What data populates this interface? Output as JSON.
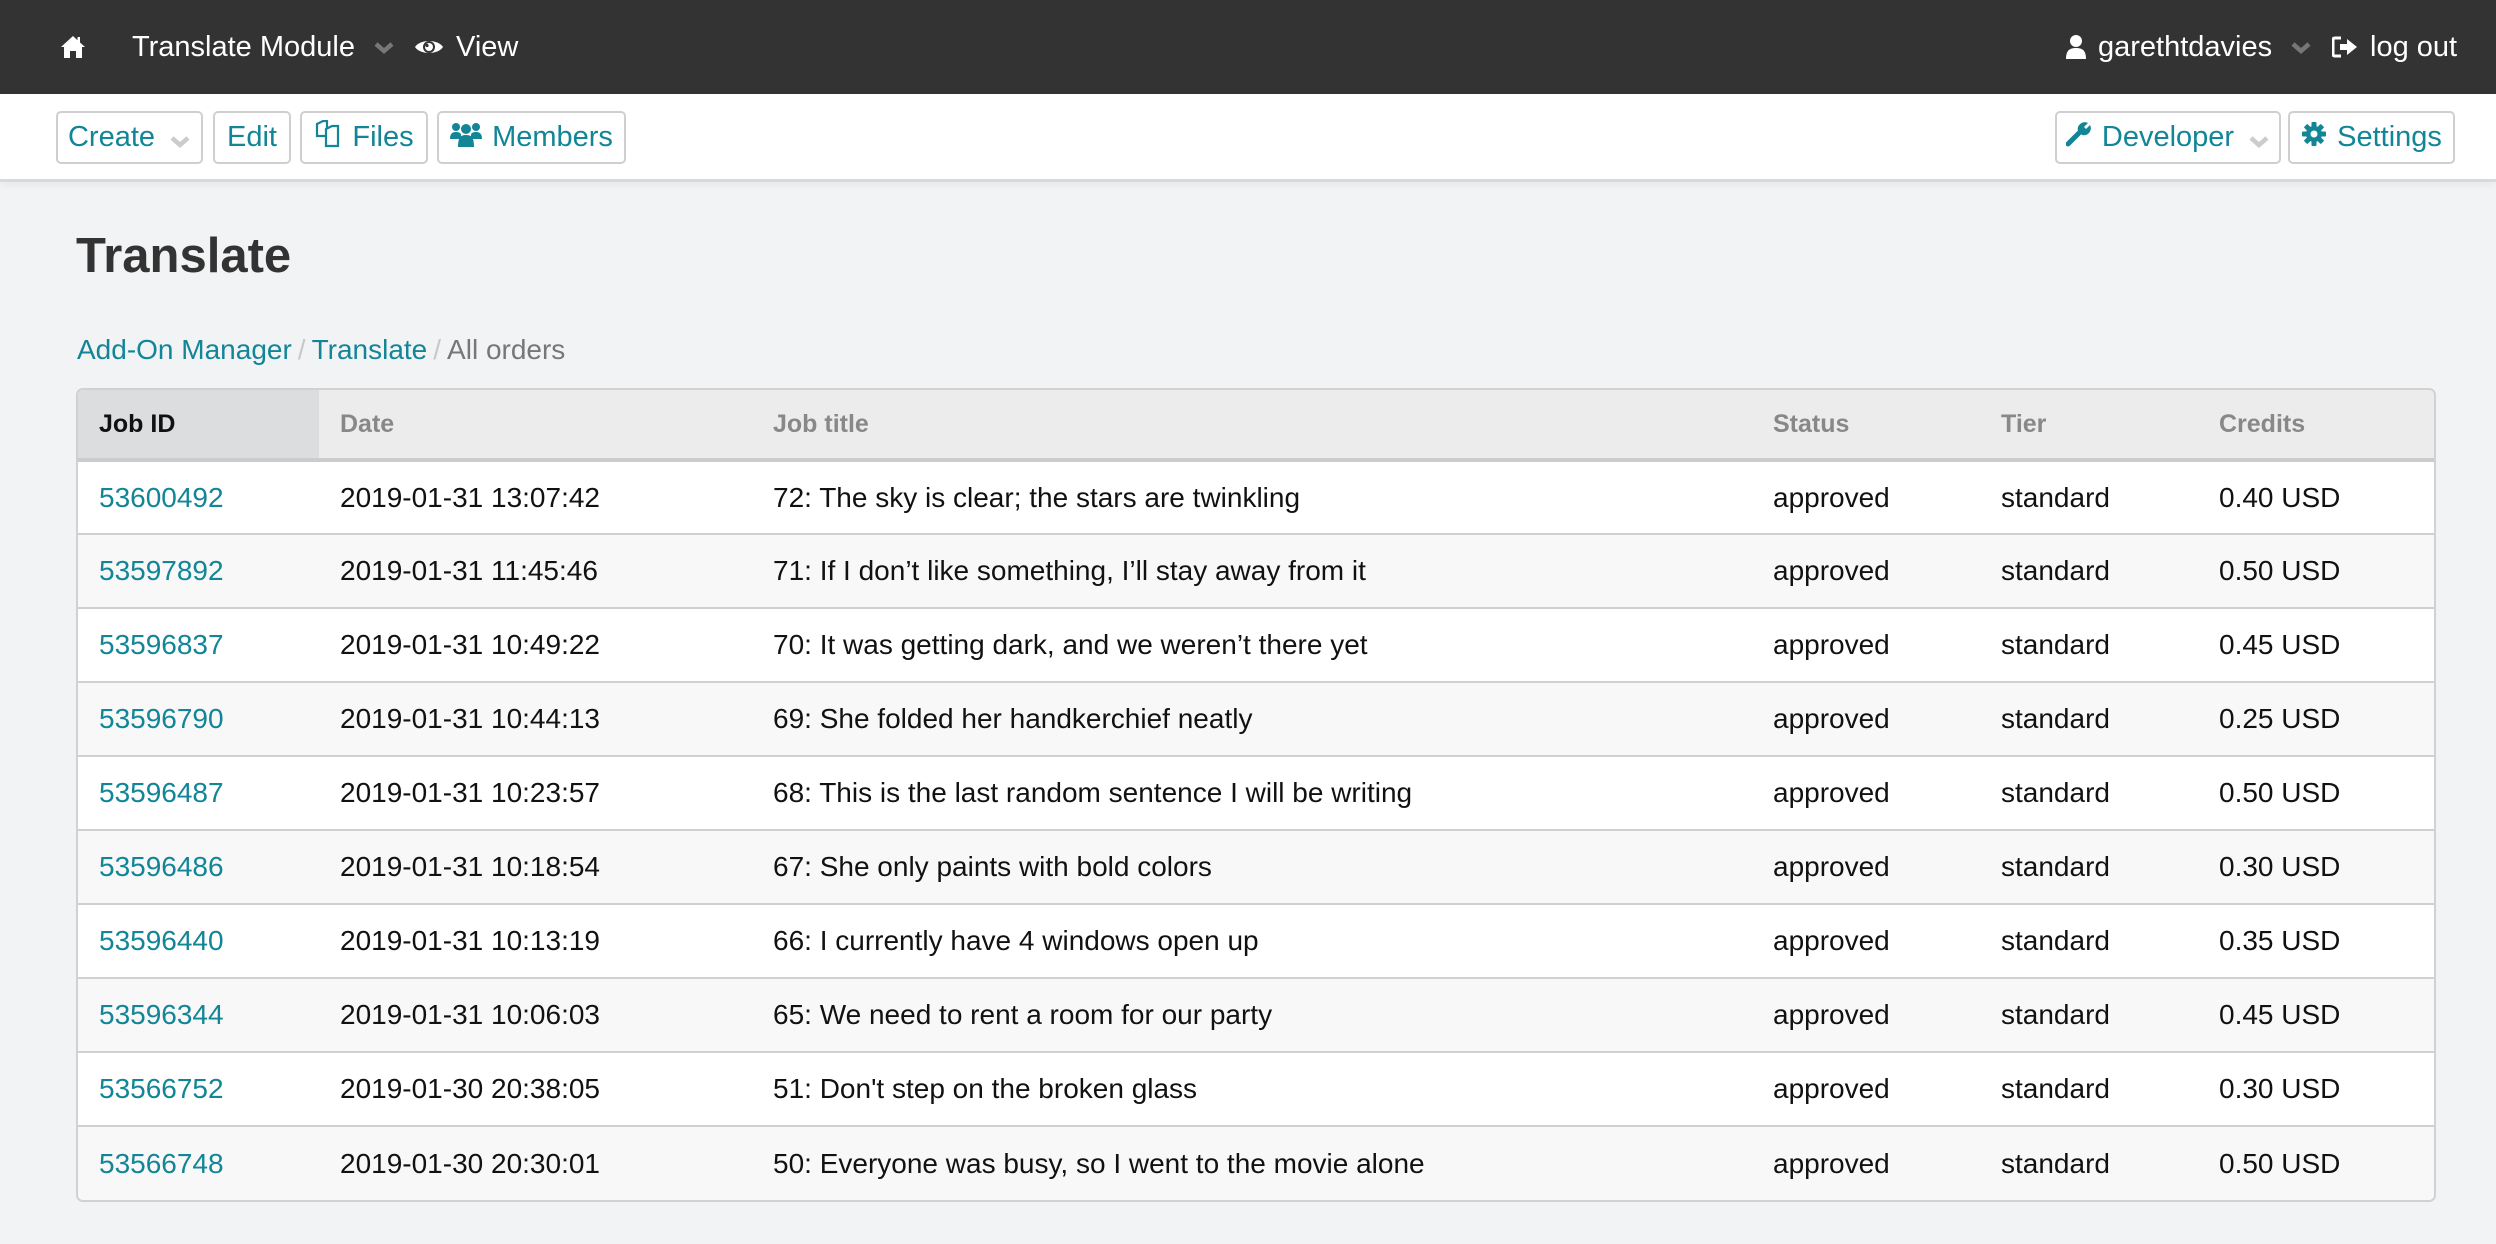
{
  "topbar": {
    "home_icon": "home-icon",
    "module": {
      "label": "Translate Module",
      "icon": "chevron-down-icon"
    },
    "view": {
      "label": "View",
      "icon": "eye-icon"
    },
    "user": {
      "label": "garethtdavies",
      "icon": "user-icon"
    },
    "logout": {
      "label": "log out",
      "icon": "sign-out-icon"
    }
  },
  "toolbar": {
    "create_label": "Create",
    "edit_label": "Edit",
    "files_label": "Files",
    "members_label": "Members",
    "developer_label": "Developer",
    "settings_label": "Settings"
  },
  "page": {
    "title": "Translate",
    "breadcrumb": [
      {
        "label": "Add-On Manager",
        "link": true
      },
      {
        "label": "Translate",
        "link": true
      },
      {
        "label": "All orders",
        "link": false
      }
    ],
    "breadcrumb_separator": "/"
  },
  "colors": {
    "accent": "#128597",
    "topbar_bg": "#333333",
    "page_bg": "#f2f3f5"
  },
  "table": {
    "sorted_column": "Job ID",
    "columns": [
      "Job ID",
      "Date",
      "Job title",
      "Status",
      "Tier",
      "Credits"
    ],
    "rows": [
      {
        "job_id": "53600492",
        "date": "2019-01-31 13:07:42",
        "title": "72: The sky is clear; the stars are twinkling",
        "status": "approved",
        "tier": "standard",
        "credits": "0.40 USD"
      },
      {
        "job_id": "53597892",
        "date": "2019-01-31 11:45:46",
        "title": "71: If I don’t like something, I’ll stay away from it",
        "status": "approved",
        "tier": "standard",
        "credits": "0.50 USD"
      },
      {
        "job_id": "53596837",
        "date": "2019-01-31 10:49:22",
        "title": "70: It was getting dark, and we weren’t there yet",
        "status": "approved",
        "tier": "standard",
        "credits": "0.45 USD"
      },
      {
        "job_id": "53596790",
        "date": "2019-01-31 10:44:13",
        "title": "69: She folded her handkerchief neatly",
        "status": "approved",
        "tier": "standard",
        "credits": "0.25 USD"
      },
      {
        "job_id": "53596487",
        "date": "2019-01-31 10:23:57",
        "title": "68: This is the last random sentence I will be writing",
        "status": "approved",
        "tier": "standard",
        "credits": "0.50 USD"
      },
      {
        "job_id": "53596486",
        "date": "2019-01-31 10:18:54",
        "title": "67: She only paints with bold colors",
        "status": "approved",
        "tier": "standard",
        "credits": "0.30 USD"
      },
      {
        "job_id": "53596440",
        "date": "2019-01-31 10:13:19",
        "title": "66: I currently have 4 windows open up",
        "status": "approved",
        "tier": "standard",
        "credits": "0.35 USD"
      },
      {
        "job_id": "53596344",
        "date": "2019-01-31 10:06:03",
        "title": "65: We need to rent a room for our party",
        "status": "approved",
        "tier": "standard",
        "credits": "0.45 USD"
      },
      {
        "job_id": "53566752",
        "date": "2019-01-30 20:38:05",
        "title": "51: Don't step on the broken glass",
        "status": "approved",
        "tier": "standard",
        "credits": "0.30 USD"
      },
      {
        "job_id": "53566748",
        "date": "2019-01-30 20:30:01",
        "title": "50: Everyone was busy, so I went to the movie alone",
        "status": "approved",
        "tier": "standard",
        "credits": "0.50 USD"
      }
    ]
  }
}
